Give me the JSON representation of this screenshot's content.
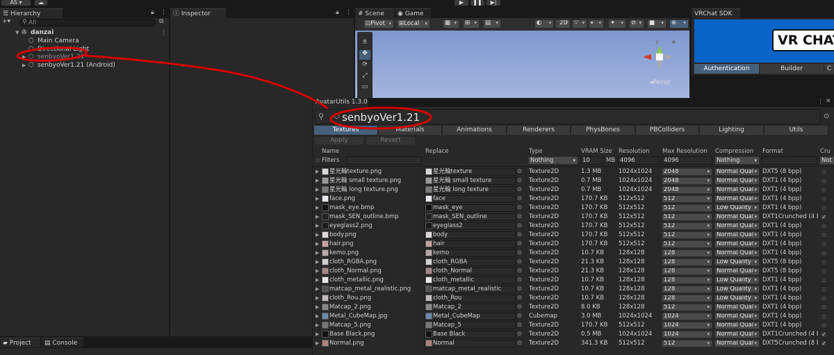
{
  "toolbar": {
    "account_label": "AS",
    "play_icon": "play-icon",
    "pause_icon": "pause-icon",
    "step_icon": "step-icon"
  },
  "hierarchy": {
    "tab_label": "Hierarchy",
    "search_placeholder": "All",
    "scene_name": "danzai",
    "items": [
      {
        "label": "Main Camera"
      },
      {
        "label": "Directional Light"
      },
      {
        "label": "senbyoVer1.21"
      },
      {
        "label": "senbyoVer1.21 (Android)"
      }
    ]
  },
  "inspector": {
    "tab_label": "Inspector"
  },
  "scene_view": {
    "tabs": [
      {
        "label": "Scene"
      },
      {
        "label": "Game"
      }
    ],
    "pivot_label": "Pivot",
    "local_label": "Local",
    "mode_2d_label": "2D",
    "persp_label": "Persp"
  },
  "vrchat_sdk": {
    "tab_label": "VRChat SDK",
    "logo_text": "VR CHAT",
    "tabs": [
      {
        "label": "Authentication"
      },
      {
        "label": "Builder"
      },
      {
        "label": "C"
      }
    ]
  },
  "bottom_tabs": [
    {
      "label": "Project"
    },
    {
      "label": "Console"
    }
  ],
  "avatar_utils": {
    "title": "AvatarUtils 1.3.0",
    "avatar_name": "senbyoVer1.21",
    "tabs": [
      {
        "label": "Textures"
      },
      {
        "label": "Materials"
      },
      {
        "label": "Animations"
      },
      {
        "label": "Renderers"
      },
      {
        "label": "PhysBones"
      },
      {
        "label": "PBColliders"
      },
      {
        "label": "Lighting"
      },
      {
        "label": "Utils"
      }
    ],
    "apply_label": "Apply",
    "revert_label": "Revert",
    "headers": {
      "name": "Name",
      "replace": "Replace",
      "type": "Type",
      "vram": "VRAM Size",
      "resolution": "Resolution",
      "max_resolution": "Max Resolution",
      "compression": "Compression",
      "format": "Format",
      "crunch": "Cru"
    },
    "filters": {
      "label": "Filters",
      "type": "Nothing",
      "vram_value": "10",
      "vram_unit": "MB",
      "resolution": "4096",
      "max_resolution": "4096",
      "compression": "Nothing",
      "crunch": "Not"
    },
    "rows": [
      {
        "name": "星光輪texture.png",
        "replace": "星光輪texture",
        "type": "Texture2D",
        "vram": "1.3 MB",
        "res": "1024x1024",
        "max": "2048",
        "comp": "Normal Qual",
        "format": "DXT5 (8 bpp)",
        "crunch": false,
        "thumb": "#d8d8d8"
      },
      {
        "name": "星光輪 small texture.png",
        "replace": "星光輪 small texture",
        "type": "Texture2D",
        "vram": "0.7 MB",
        "res": "1024x1024",
        "max": "2048",
        "comp": "Normal Qual",
        "format": "DXT1 (4 bpp)",
        "crunch": false,
        "thumb": "#9a9a9a"
      },
      {
        "name": "星光輪 long texture.png",
        "replace": "星光輪 long texture",
        "type": "Texture2D",
        "vram": "0.7 MB",
        "res": "1024x1024",
        "max": "2048",
        "comp": "Normal Qual",
        "format": "DXT1 (4 bpp)",
        "crunch": false,
        "thumb": "#7a7a7a"
      },
      {
        "name": "face.png",
        "replace": "face",
        "type": "Texture2D",
        "vram": "170.7 KB",
        "res": "512x512",
        "max": "512",
        "comp": "Normal Qual",
        "format": "DXT1 (4 bpp)",
        "crunch": false,
        "thumb": "#e8e8f0"
      },
      {
        "name": "mask_eye.bmp",
        "replace": "mask_eye",
        "type": "Texture2D",
        "vram": "170.7 KB",
        "res": "512x512",
        "max": "512",
        "comp": "Low Quality",
        "format": "DXT1 (4 bpp)",
        "crunch": false,
        "thumb": "#111111"
      },
      {
        "name": "mask_SEN_outline.bmp",
        "replace": "mask_SEN_outline",
        "type": "Texture2D",
        "vram": "170.7 KB",
        "res": "512x512",
        "max": "512",
        "comp": "Normal Qual",
        "format": "DXT1Crunched (4 b",
        "crunch": true,
        "thumb": "#222222"
      },
      {
        "name": "eyeglass2.png",
        "replace": "eyeglass2",
        "type": "Texture2D",
        "vram": "170.7 KB",
        "res": "512x512",
        "max": "512",
        "comp": "Normal Qual",
        "format": "DXT1 (4 bpp)",
        "crunch": false,
        "thumb": "#1a1a1a"
      },
      {
        "name": "body.png",
        "replace": "body",
        "type": "Texture2D",
        "vram": "170.7 KB",
        "res": "512x512",
        "max": "512",
        "comp": "Normal Qual",
        "format": "DXT1 (4 bpp)",
        "crunch": false,
        "thumb": "#e0d8d8"
      },
      {
        "name": "hair.png",
        "replace": "hair",
        "type": "Texture2D",
        "vram": "170.7 KB",
        "res": "512x512",
        "max": "512",
        "comp": "Normal Qual",
        "format": "DXT1 (4 bpp)",
        "crunch": false,
        "thumb": "#c8a0a0"
      },
      {
        "name": "kemo.png",
        "replace": "kemo",
        "type": "Texture2D",
        "vram": "10.7 KB",
        "res": "128x128",
        "max": "128",
        "comp": "Normal Qual",
        "format": "DXT1 (4 bpp)",
        "crunch": false,
        "thumb": "#b8a8a8"
      },
      {
        "name": "cloth_RGBA.png",
        "replace": "cloth_RGBA",
        "type": "Texture2D",
        "vram": "21.3 KB",
        "res": "128x128",
        "max": "128",
        "comp": "Low Quality",
        "format": "DXT5 (8 bpp)",
        "crunch": false,
        "thumb": "#d0d0d0"
      },
      {
        "name": "cloth_Normal.png",
        "replace": "cloth_Normal",
        "type": "Texture2D",
        "vram": "21.3 KB",
        "res": "128x128",
        "max": "128",
        "comp": "Normal Qual",
        "format": "DXT5 (8 bpp)",
        "crunch": false,
        "thumb": "#a88888"
      },
      {
        "name": "cloth_metallic.png",
        "replace": "cloth_metallic",
        "type": "Texture2D",
        "vram": "10.7 KB",
        "res": "128x128",
        "max": "128",
        "comp": "Low Quality",
        "format": "DXT1 (4 bpp)",
        "crunch": false,
        "thumb": "#e8e8e8"
      },
      {
        "name": "matcap_metal_realistic.png",
        "replace": "matcap_metal_realistic",
        "type": "Texture2D",
        "vram": "10.7 KB",
        "res": "128x128",
        "max": "128",
        "comp": "Low Quality",
        "format": "DXT1 (4 bpp)",
        "crunch": false,
        "thumb": "#555555"
      },
      {
        "name": "cloth_Rou.png",
        "replace": "cloth_Rou",
        "type": "Texture2D",
        "vram": "10.7 KB",
        "res": "128x128",
        "max": "128",
        "comp": "Low Quality",
        "format": "DXT1 (4 bpp)",
        "crunch": false,
        "thumb": "#c0b8b8"
      },
      {
        "name": "Matcap_2.png",
        "replace": "Matcap_2",
        "type": "Texture2D",
        "vram": "8.0 KB",
        "res": "128x128",
        "max": "512",
        "comp": "Normal Qual",
        "format": "DXT1 (4 bpp)",
        "crunch": false,
        "thumb": "#888888"
      },
      {
        "name": "Metal_CubeMap.jpg",
        "replace": "Metal_CubeMap",
        "type": "Cubemap",
        "vram": "3.0 MB",
        "res": "1024x1024",
        "max": "1024",
        "comp": "Normal Qual",
        "format": "DXT1 (4 bpp)",
        "crunch": false,
        "thumb": "#6a8ab0"
      },
      {
        "name": "Matcap_5.png",
        "replace": "Matcap_5",
        "type": "Texture2D",
        "vram": "170.7 KB",
        "res": "512x512",
        "max": "1024",
        "comp": "Normal Qual",
        "format": "DXT1 (4 bpp)",
        "crunch": false,
        "thumb": "#777777"
      },
      {
        "name": "Base Black.png",
        "replace": "Base Black",
        "type": "Texture2D",
        "vram": "0.5 MB",
        "res": "1024x1024",
        "max": "1024",
        "comp": "Normal Qual",
        "format": "DXT1Crunched (4 b",
        "crunch": true,
        "thumb": "#111111"
      },
      {
        "name": "Normal.png",
        "replace": "Normal",
        "type": "Texture2D",
        "vram": "341.3 KB",
        "res": "512x512",
        "max": "512",
        "comp": "Normal Qual",
        "format": "DXT5Crunched (8 b",
        "crunch": true,
        "thumb": "#b08080"
      }
    ]
  },
  "colors": {
    "accent_tab": "#46607c",
    "scene_sky": "#8fa6d6",
    "annotation_red": "#d40000",
    "vrchat_blue": "#0a64c8"
  }
}
